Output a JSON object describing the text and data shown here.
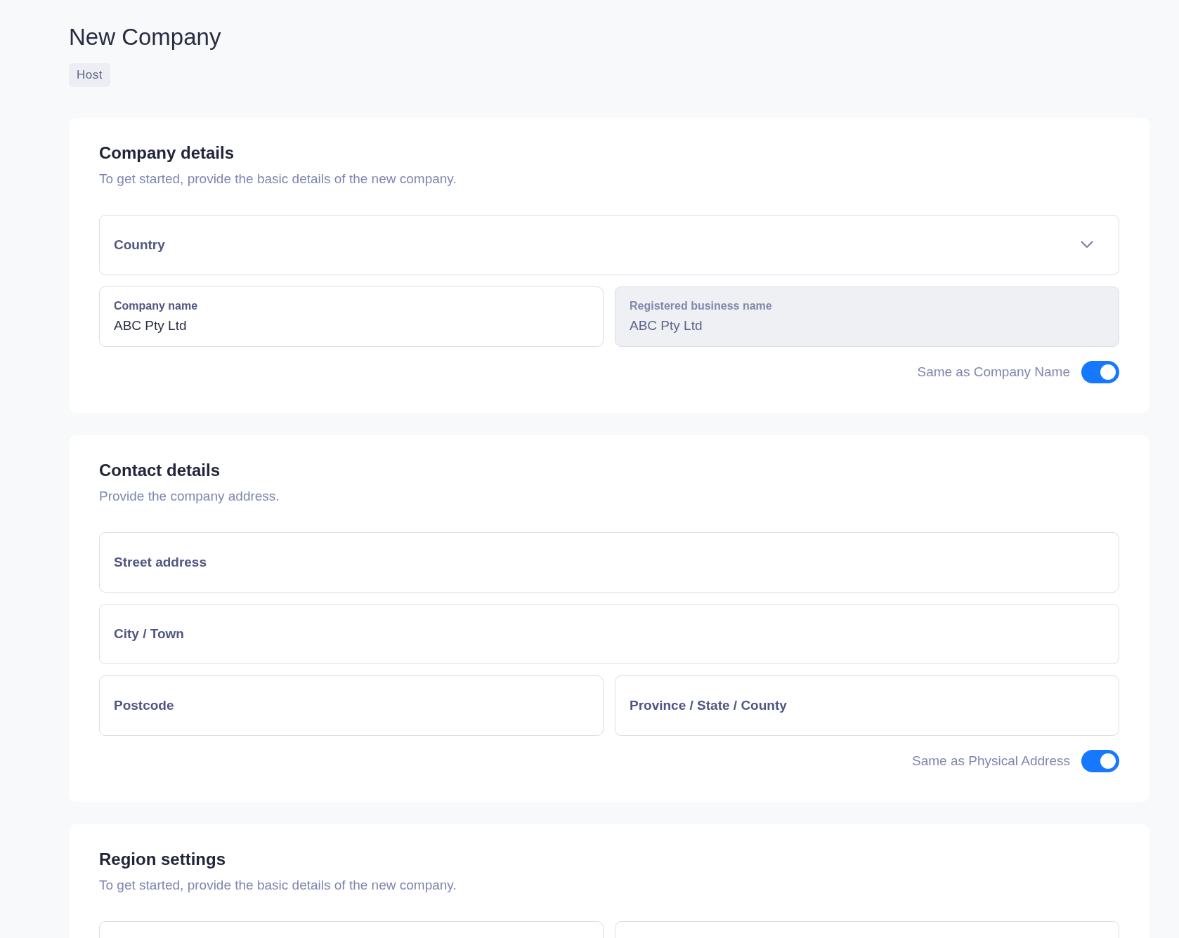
{
  "page": {
    "title": "New Company",
    "badge": "Host"
  },
  "sections": [
    {
      "title": "Company details",
      "subtitle": "To get started, provide the basic details of the new company.",
      "rows": [
        [
          {
            "kind": "select",
            "label": "Country",
            "disabled": false
          }
        ],
        [
          {
            "kind": "text",
            "label": "Company name",
            "value": "ABC Pty Ltd",
            "disabled": false
          },
          {
            "kind": "text",
            "label": "Registered business name",
            "value": "ABC Pty Ltd",
            "disabled": true
          }
        ]
      ],
      "toggle": {
        "label": "Same as Company Name",
        "on": true
      }
    },
    {
      "title": "Contact details",
      "subtitle": "Provide the company address.",
      "rows": [
        [
          {
            "kind": "text",
            "label": "Street address",
            "disabled": false
          }
        ],
        [
          {
            "kind": "text",
            "label": "City / Town",
            "disabled": false
          }
        ],
        [
          {
            "kind": "text",
            "label": "Postcode",
            "disabled": false
          },
          {
            "kind": "text",
            "label": "Province / State / County",
            "disabled": false
          }
        ]
      ],
      "toggle": {
        "label": "Same as Physical Address",
        "on": true
      }
    },
    {
      "title": "Region settings",
      "subtitle": "To get started, provide the basic details of the new company.",
      "rows": [
        [
          {
            "kind": "text",
            "disabled": false
          },
          {
            "kind": "text",
            "disabled": false
          }
        ]
      ]
    }
  ]
}
